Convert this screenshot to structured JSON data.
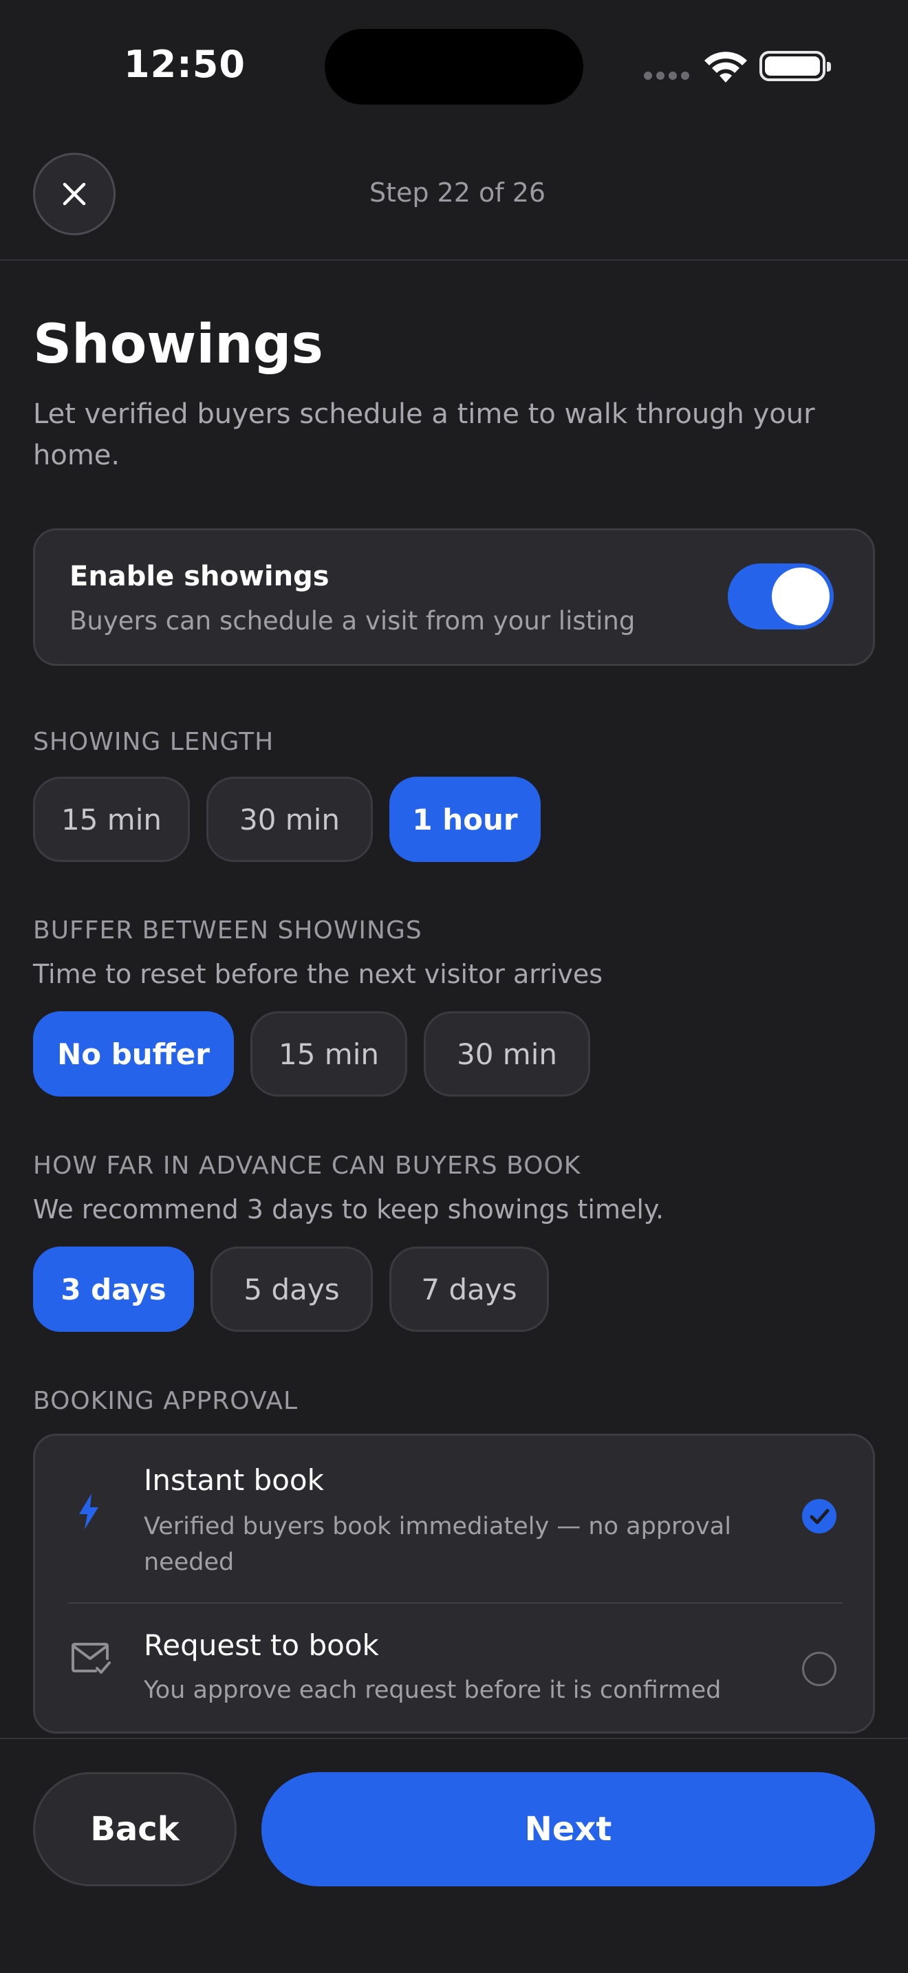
{
  "status_bar": {
    "time": "12:50"
  },
  "header": {
    "step_text": "Step 22 of 26"
  },
  "page": {
    "title": "Showings",
    "subtitle": "Let verified buyers schedule a time to walk through your home."
  },
  "enable": {
    "title": "Enable showings",
    "description": "Buyers can schedule a visit from your listing",
    "toggle_on": true
  },
  "showing_length": {
    "label": "SHOWING LENGTH",
    "options": [
      "15 min",
      "30 min",
      "1 hour"
    ],
    "selected": "1 hour"
  },
  "buffer": {
    "label": "BUFFER BETWEEN SHOWINGS",
    "hint": "Time to reset before the next visitor arrives",
    "options": [
      "No buffer",
      "15 min",
      "30 min"
    ],
    "selected": "No buffer"
  },
  "advance": {
    "label": "HOW FAR IN ADVANCE CAN BUYERS BOOK",
    "hint": "We recommend 3 days to keep showings timely.",
    "options": [
      "3 days",
      "5 days",
      "7 days"
    ],
    "selected": "3 days"
  },
  "approval": {
    "label": "BOOKING APPROVAL",
    "options": [
      {
        "title": "Instant book",
        "description": "Verified buyers book immediately — no approval needed",
        "icon": "lightning-icon",
        "checked": true
      },
      {
        "title": "Request to book",
        "description": "You approve each request before it is confirmed",
        "icon": "mail-check-icon",
        "checked": false
      }
    ]
  },
  "footer": {
    "back_label": "Back",
    "next_label": "Next"
  },
  "colors": {
    "accent": "#2563eb",
    "background": "#1d1d20",
    "card": "#2b2b2f"
  }
}
